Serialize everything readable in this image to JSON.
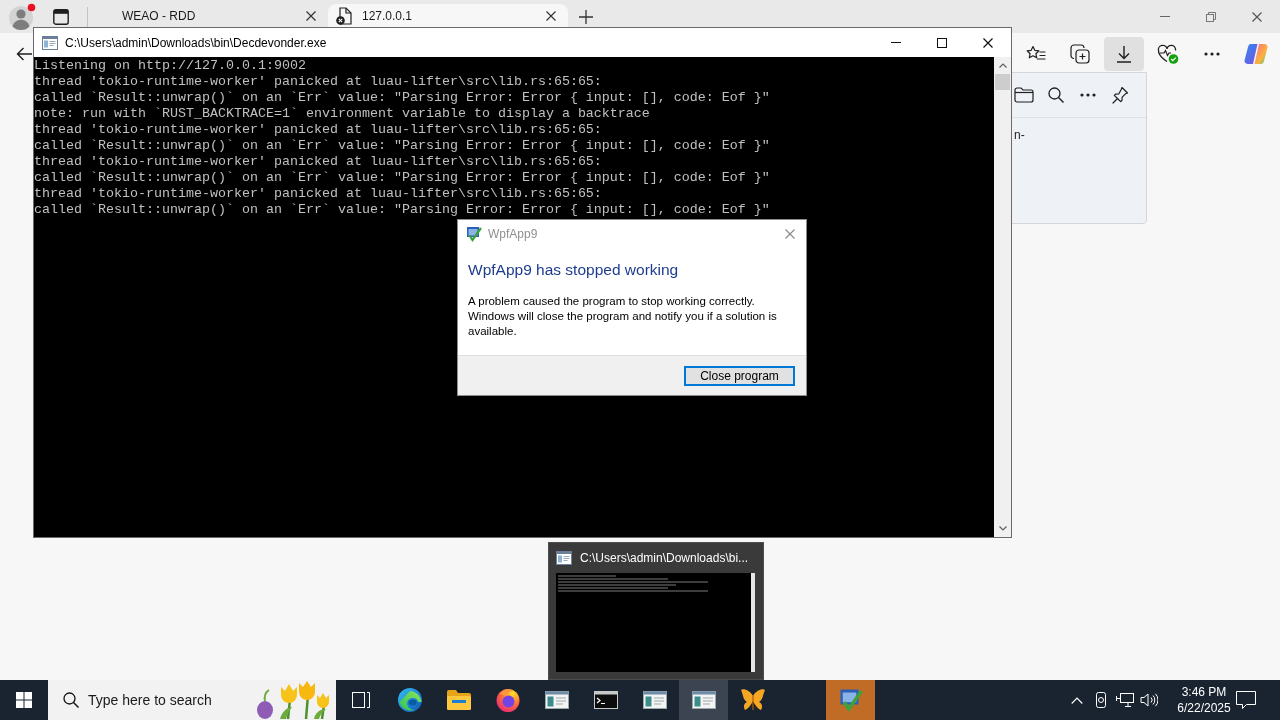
{
  "browser": {
    "tabs": [
      {
        "title": "WEAO - RDD",
        "load_error": false,
        "selected": false
      },
      {
        "title": "127.0.0.1",
        "load_error": true,
        "selected": true
      }
    ],
    "toolbar_buttons": [
      {
        "kind": "favorites",
        "selected": false
      },
      {
        "kind": "collections",
        "selected": false
      },
      {
        "kind": "downloads",
        "selected": true
      },
      {
        "kind": "essentials",
        "selected": false
      },
      {
        "kind": "more",
        "selected": false
      },
      {
        "kind": "copilot",
        "selected": false
      }
    ],
    "downloads_panel": {
      "text": "n-"
    }
  },
  "console_window": {
    "title": "C:\\Users\\admin\\Downloads\\bin\\Decdevonder.exe",
    "lines": [
      "Listening on http://127.0.0.1:9002",
      "thread 'tokio-runtime-worker' panicked at luau-lifter\\src\\lib.rs:65:65:",
      "called `Result::unwrap()` on an `Err` value: \"Parsing Error: Error { input: [], code: Eof }\"",
      "note: run with `RUST_BACKTRACE=1` environment variable to display a backtrace",
      "thread 'tokio-runtime-worker' panicked at luau-lifter\\src\\lib.rs:65:65:",
      "called `Result::unwrap()` on an `Err` value: \"Parsing Error: Error { input: [], code: Eof }\"",
      "thread 'tokio-runtime-worker' panicked at luau-lifter\\src\\lib.rs:65:65:",
      "called `Result::unwrap()` on an `Err` value: \"Parsing Error: Error { input: [], code: Eof }\"",
      "thread 'tokio-runtime-worker' panicked at luau-lifter\\src\\lib.rs:65:65:",
      "called `Result::unwrap()` on an `Err` value: \"Parsing Error: Error { input: [], code: Eof }\""
    ]
  },
  "error_dialog": {
    "title": "WpfApp9",
    "heading": "WpfApp9 has stopped working",
    "message": "A problem caused the program to stop working correctly. Windows will close the program and notify you if a solution is available.",
    "button": "Close program"
  },
  "taskbar_preview": {
    "title": "C:\\Users\\admin\\Downloads\\bi..."
  },
  "taskbar": {
    "search": {
      "placeholder": "Type here to search"
    },
    "apps": [
      {
        "kind": "task-view",
        "active": false,
        "flashing": false
      },
      {
        "kind": "edge",
        "active": false,
        "flashing": false
      },
      {
        "kind": "file-explorer",
        "active": false,
        "flashing": false
      },
      {
        "kind": "firefox",
        "active": false,
        "flashing": false
      },
      {
        "kind": "window-app",
        "active": false,
        "flashing": false
      },
      {
        "kind": "terminal",
        "active": false,
        "flashing": false
      },
      {
        "kind": "window-app",
        "active": false,
        "flashing": false
      },
      {
        "kind": "window-app",
        "active": true,
        "flashing": false
      },
      {
        "kind": "butterfly",
        "active": false,
        "flashing": false
      },
      {
        "kind": "error-app",
        "active": false,
        "flashing": true
      }
    ],
    "time": "3:46 PM",
    "date": "6/22/2025"
  }
}
